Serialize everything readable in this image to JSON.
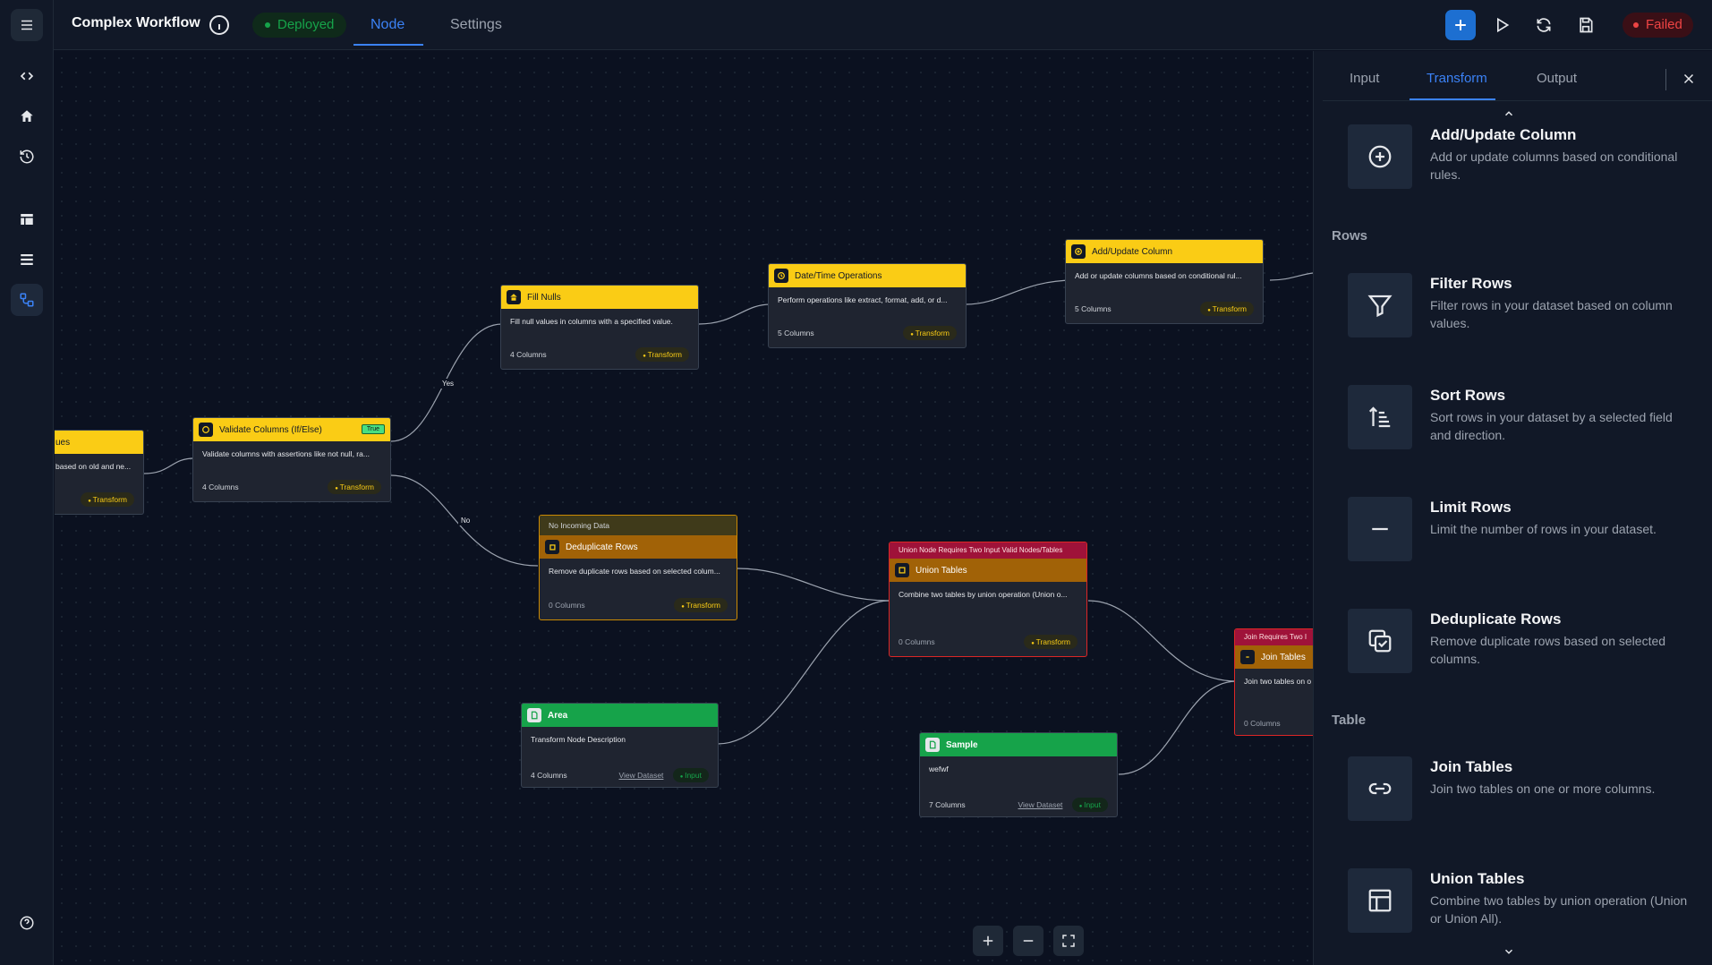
{
  "header": {
    "title": "Complex Workflow",
    "status": "Deployed",
    "tabs": [
      "Node",
      "Settings"
    ],
    "active_tab": "Node",
    "run_status": "Failed"
  },
  "rail_icons": [
    "menu-icon",
    "code-icon",
    "home-icon",
    "history-icon",
    "table-icon",
    "list-icon",
    "workflow-icon",
    "help-icon"
  ],
  "canvas": {
    "edge_labels": {
      "yes": "Yes",
      "no": "No"
    },
    "nodes": {
      "replace_values": {
        "title": "ues",
        "desc": "based on old and ne...",
        "badge": "Transform"
      },
      "validate": {
        "title": "Validate Columns (If/Else)",
        "true_badge": "True",
        "desc": "Validate columns with assertions like not null, ra...",
        "columns": "4 Columns",
        "badge": "Transform"
      },
      "fill_nulls": {
        "title": "Fill Nulls",
        "desc": "Fill null values in columns with a specified value.",
        "columns": "4 Columns",
        "badge": "Transform"
      },
      "datetime": {
        "title": "Date/Time Operations",
        "desc": "Perform operations like extract, format, add, or d...",
        "columns": "5 Columns",
        "badge": "Transform"
      },
      "add_update": {
        "title": "Add/Update Column",
        "desc": "Add or update columns based on conditional rul...",
        "columns": "5 Columns",
        "badge": "Transform"
      },
      "dedupe": {
        "warning": "No Incoming Data",
        "title": "Deduplicate Rows",
        "desc": "Remove duplicate rows based on selected colum...",
        "columns": "0 Columns",
        "badge": "Transform"
      },
      "union": {
        "error": "Union Node Requires Two Input Valid Nodes/Tables",
        "title": "Union Tables",
        "desc": "Combine two tables by union operation (Union o...",
        "columns": "0 Columns",
        "badge": "Transform"
      },
      "area": {
        "title": "Area",
        "desc": "Transform Node Description",
        "columns": "4 Columns",
        "view": "View Dataset",
        "badge": "Input"
      },
      "sample": {
        "title": "Sample",
        "desc": "wefwf",
        "columns": "7 Columns",
        "view": "View Dataset",
        "badge": "Input"
      },
      "join": {
        "error": "Join Requires Two I",
        "title": "Join Tables",
        "desc": "Join two tables on o",
        "columns": "0 Columns"
      }
    }
  },
  "panel": {
    "tabs": [
      "Input",
      "Transform",
      "Output"
    ],
    "active_tab": "Transform",
    "top_card": {
      "title": "Add/Update Column",
      "desc": "Add or update columns based on conditional rules.",
      "icon": "plus-circle-icon"
    },
    "sections": [
      {
        "name": "Rows",
        "cards": [
          {
            "title": "Filter Rows",
            "desc": "Filter rows in your dataset based on column values.",
            "icon": "filter-icon"
          },
          {
            "title": "Sort Rows",
            "desc": "Sort rows in your dataset by a selected field and direction.",
            "icon": "sort-icon"
          },
          {
            "title": "Limit Rows",
            "desc": "Limit the number of rows in your dataset.",
            "icon": "minus-icon"
          },
          {
            "title": "Deduplicate Rows",
            "desc": "Remove duplicate rows based on selected columns.",
            "icon": "copy-check-icon"
          }
        ]
      },
      {
        "name": "Table",
        "cards": [
          {
            "title": "Join Tables",
            "desc": "Join two tables on one or more columns.",
            "icon": "link-icon"
          },
          {
            "title": "Union Tables",
            "desc": "Combine two tables by union operation (Union or Union All).",
            "icon": "table-icon"
          }
        ]
      }
    ]
  },
  "colors": {
    "accent": "#3b82f6",
    "transform_header": "#facc15",
    "input_header": "#16a34a",
    "error": "#dc2626",
    "deployed": "#16a34a",
    "failed": "#ef4444"
  }
}
